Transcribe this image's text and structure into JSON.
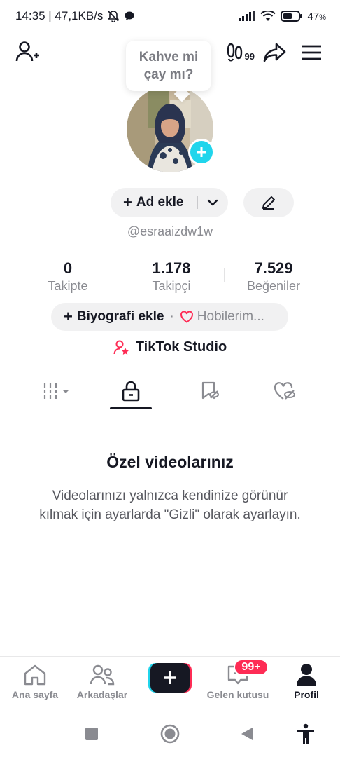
{
  "status": {
    "time_speed": "14:35 | 47,1KB/s",
    "battery": "47"
  },
  "top_nav": {
    "bubble_count": "99"
  },
  "tooltip": {
    "text": "Kahve mi çay mı?"
  },
  "profile": {
    "add_name_label": "Ad ekle",
    "username": "@esraaizdw1w"
  },
  "stats": [
    {
      "value": "0",
      "label": "Takipte"
    },
    {
      "value": "1.178",
      "label": "Takipçi"
    },
    {
      "value": "7.529",
      "label": "Beğeniler"
    }
  ],
  "bio": {
    "add_bio_label": "Biyografi ekle",
    "separator": "·",
    "hobbies_label": "Hobilerim..."
  },
  "studio": {
    "label": "TikTok Studio"
  },
  "tabs": [
    {
      "icon": "grid-icon",
      "active": false
    },
    {
      "icon": "lock-icon",
      "active": true
    },
    {
      "icon": "bookmark-icon",
      "active": false
    },
    {
      "icon": "liked-icon",
      "active": false
    }
  ],
  "empty_state": {
    "title": "Özel videolarınız",
    "description": "Videolarınızı yalnızca kendinize görünür kılmak için ayarlarda \"Gizli\" olarak ayarlayın."
  },
  "bottom_nav": {
    "items": [
      {
        "label": "Ana sayfa",
        "active": false
      },
      {
        "label": "Arkadaşlar",
        "active": false
      },
      {
        "label": "Gelen kutusu",
        "active": false
      },
      {
        "label": "Profil",
        "active": true
      }
    ],
    "inbox_badge": "99+"
  },
  "colors": {
    "accent_cyan": "#20d5ec",
    "accent_red": "#fe2c55",
    "text_primary": "#161823",
    "text_secondary": "#8a8b91",
    "button_bg": "#f1f1f2"
  }
}
